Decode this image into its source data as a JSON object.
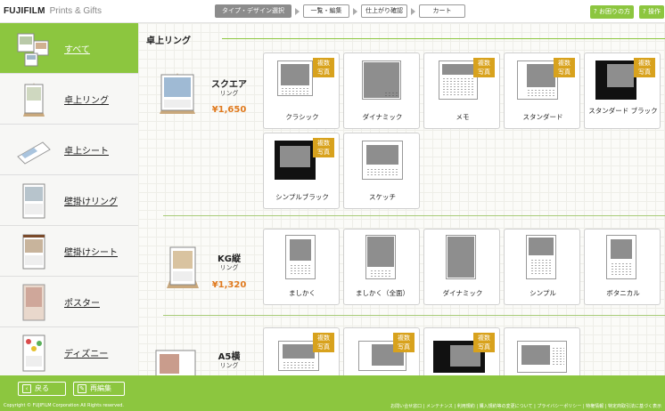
{
  "header": {
    "logo_brand": "FUJIFILM",
    "logo_service": "Prints & Gifts",
    "steps": [
      "タイプ・デザイン選択",
      "一覧・編集",
      "仕上がり確認",
      "カート"
    ],
    "help_label": "お困りの方",
    "guide_label": "操作"
  },
  "sidebar": {
    "items": [
      {
        "label": "すべて",
        "active": true
      },
      {
        "label": "卓上リング"
      },
      {
        "label": "卓上シート"
      },
      {
        "label": "壁掛けリング"
      },
      {
        "label": "壁掛けシート"
      },
      {
        "label": "ポスター"
      },
      {
        "label": "ディズニー"
      }
    ]
  },
  "main": {
    "section_title": "卓上リング",
    "products": [
      {
        "name": "スクエア",
        "sub": "リング",
        "price": "¥1,650",
        "designs": [
          {
            "name": "クラシック",
            "badge": "複数\n写真"
          },
          {
            "name": "ダイナミック"
          },
          {
            "name": "メモ",
            "badge": "複数\n写真"
          },
          {
            "name": "スタンダード",
            "badge": "複数\n写真"
          },
          {
            "name": "スタンダード ブラック",
            "badge": "複数\n写真"
          },
          {
            "name": "シンプルブラック",
            "badge": "複数\n写真"
          },
          {
            "name": "スケッチ"
          }
        ]
      },
      {
        "name": "KG縦",
        "sub": "リング",
        "price": "¥1,320",
        "designs": [
          {
            "name": "ましかく"
          },
          {
            "name": "ましかく（全面）"
          },
          {
            "name": "ダイナミック"
          },
          {
            "name": "シンプル"
          },
          {
            "name": "ボタニカル"
          }
        ]
      },
      {
        "name": "A5横",
        "sub": "リング",
        "price": "",
        "designs": [
          {
            "name": "",
            "badge": "複数\n写真"
          },
          {
            "name": "",
            "badge": "複数\n写真"
          },
          {
            "name": "",
            "badge": "複数\n写真"
          },
          {
            "name": ""
          }
        ]
      }
    ]
  },
  "footer": {
    "back_label": "戻る",
    "reedit_label": "再編集",
    "copyright": "Copyright © FUJIFILM Corporation All Rights reserved.",
    "links": "お問い合せ窓口 | メンテナンス | 利用規約 | 購入規約等の変更について | プライバシーポリシー | 特権情報 | 特定商取引法に基づく表示"
  },
  "colors": {
    "accent": "#8cc63f",
    "price": "#e07a1e",
    "badge": "#d8a21d"
  }
}
